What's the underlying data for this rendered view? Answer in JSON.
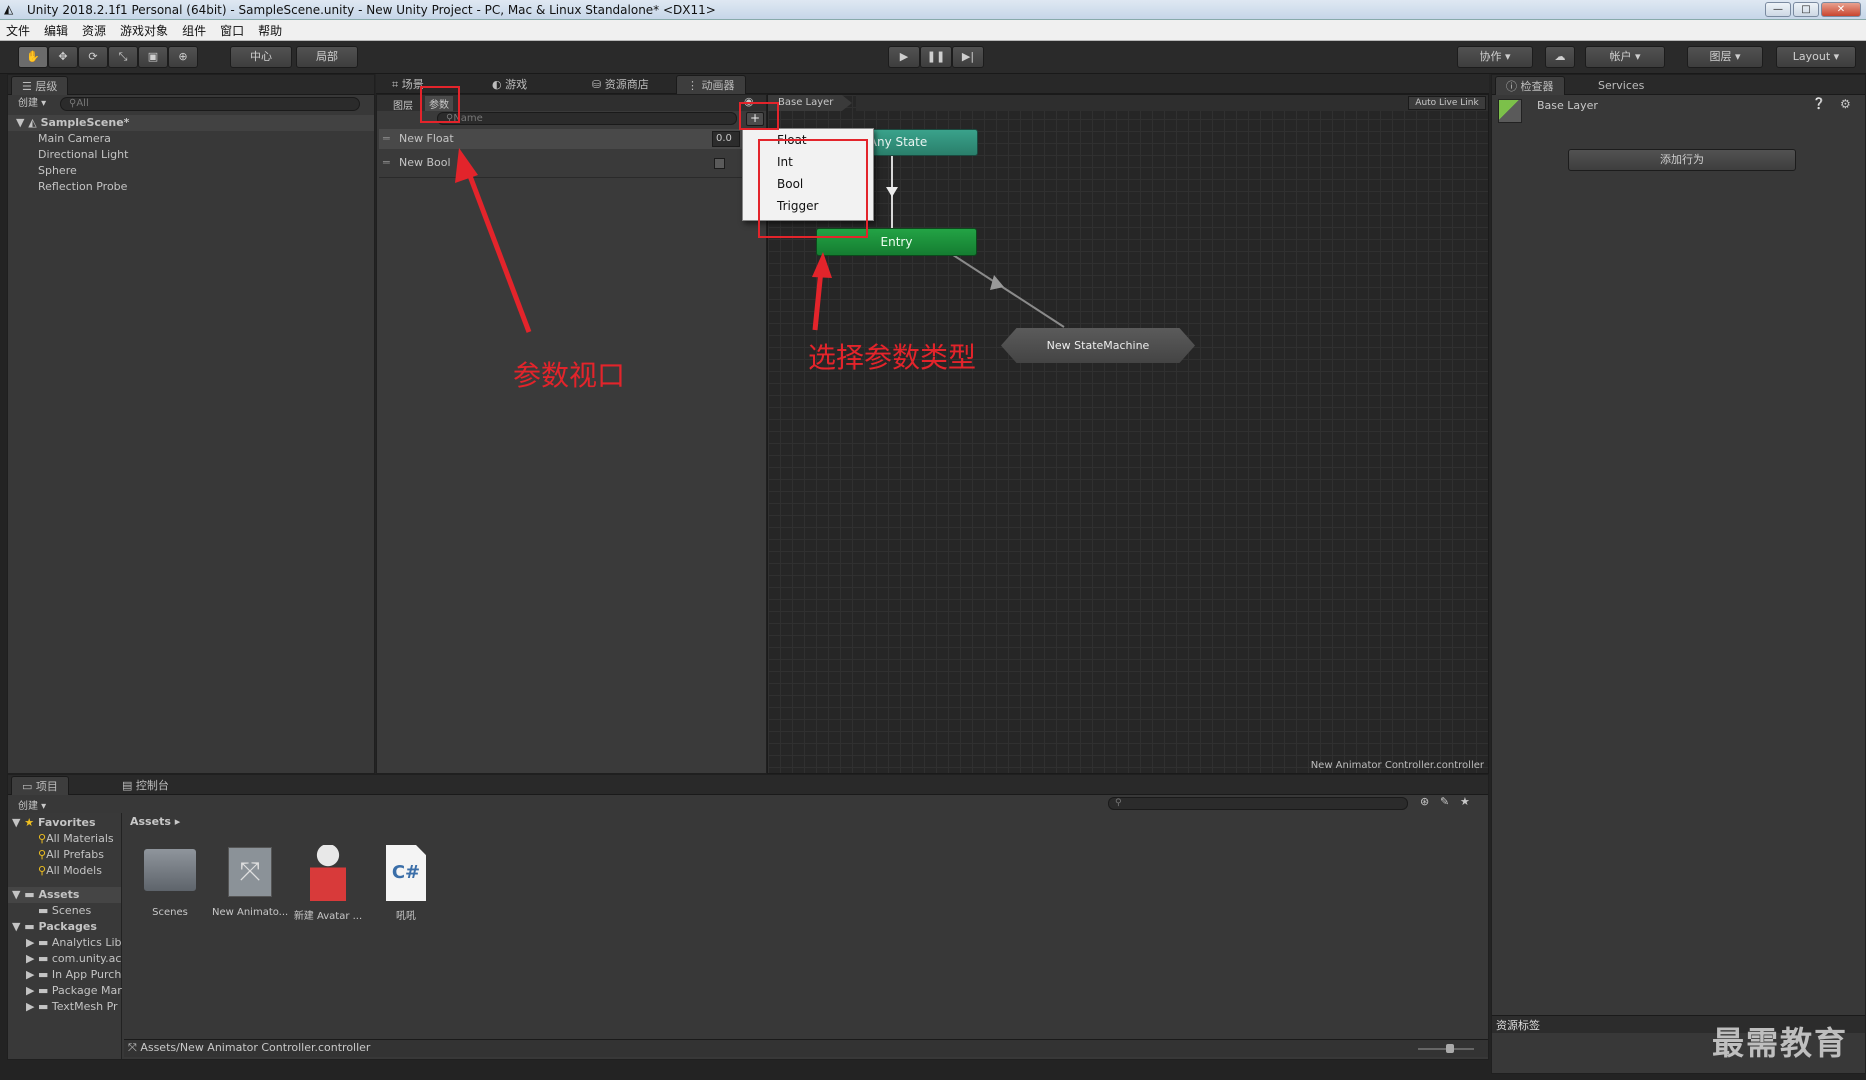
{
  "window": {
    "title": "Unity 2018.2.1f1 Personal (64bit) - SampleScene.unity - New Unity Project - PC, Mac & Linux Standalone* <DX11>",
    "minimize": "—",
    "maximize": "□",
    "close": "✕"
  },
  "menu": [
    "文件",
    "编辑",
    "资源",
    "游戏对象",
    "组件",
    "窗口",
    "帮助"
  ],
  "toolbar": {
    "pivot": "中心",
    "space": "局部",
    "collab": "协作",
    "account": "帐户",
    "layers": "图层",
    "layout": "Layout"
  },
  "hierarchy": {
    "tab": "层级",
    "create": "创建",
    "search_placeholder": "All",
    "scene": "SampleScene*",
    "items": [
      "Main Camera",
      "Directional Light",
      "Sphere",
      "Reflection Probe"
    ]
  },
  "center_tabs": [
    "场景",
    "游戏",
    "资源商店",
    "动画器"
  ],
  "animator": {
    "subtabs": [
      "图层",
      "参数"
    ],
    "search_placeholder": "Name",
    "params": [
      {
        "name": "New Float",
        "value": "0.0"
      },
      {
        "name": "New Bool",
        "value": ""
      }
    ],
    "add_button": "+",
    "dropdown": [
      "Float",
      "Int",
      "Bool",
      "Trigger"
    ],
    "breadcrumb": "Base Layer",
    "auto_live_link": "Auto Live Link",
    "nodes": {
      "any_state": "Any State",
      "entry": "Entry",
      "state_machine": "New StateMachine"
    },
    "footer": "New Animator Controller.controller"
  },
  "annotations": {
    "params_view": "参数视口",
    "select_type": "选择参数类型"
  },
  "inspector": {
    "tabs": [
      "检查器",
      "Services"
    ],
    "title": "Base Layer",
    "add_behaviour": "添加行为",
    "asset_labels": "资源标签"
  },
  "project": {
    "tabs": [
      "项目",
      "控制台"
    ],
    "create": "创建",
    "favorites": {
      "label": "Favorites",
      "items": [
        "All Materials",
        "All Prefabs",
        "All Models"
      ]
    },
    "assets": {
      "label": "Assets",
      "items": [
        "Scenes"
      ]
    },
    "packages": {
      "label": "Packages",
      "items": [
        "Analytics Lib",
        "com.unity.ac",
        "In App Purch",
        "Package Mar",
        "TextMesh Pr"
      ]
    },
    "breadcrumb": "Assets",
    "tiles": [
      "Scenes",
      "New Animato...",
      "新建 Avatar ...",
      "吼吼"
    ],
    "cs_label": "C#",
    "status_path": "Assets/New Animator Controller.controller"
  },
  "watermark": "最需教育",
  "colors": {
    "annotation": "#e3242b",
    "entry_green": "#1c8f3a",
    "any_state_teal": "#2f8f7a",
    "graph_bg": "#262626",
    "panel": "#383838"
  }
}
